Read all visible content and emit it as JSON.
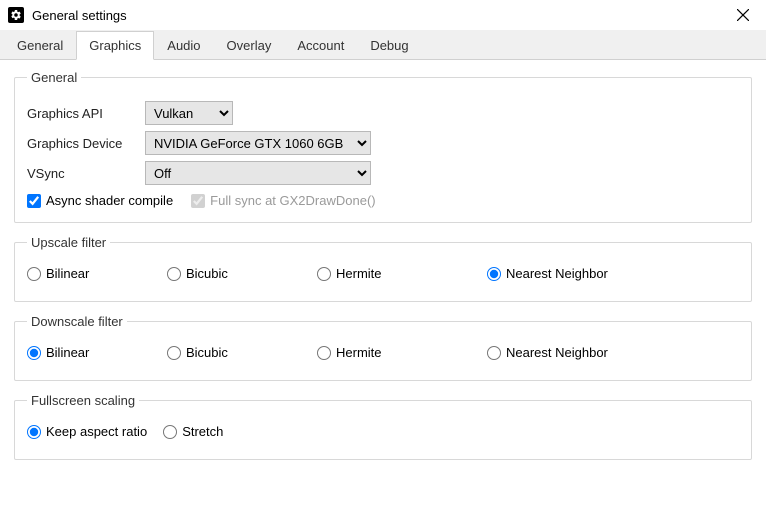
{
  "window": {
    "title": "General settings"
  },
  "tabs": [
    "General",
    "Graphics",
    "Audio",
    "Overlay",
    "Account",
    "Debug"
  ],
  "active_tab": 1,
  "general_group": {
    "legend": "General",
    "graphics_api_label": "Graphics API",
    "graphics_api_value": "Vulkan",
    "graphics_device_label": "Graphics Device",
    "graphics_device_value": "NVIDIA GeForce GTX 1060 6GB",
    "vsync_label": "VSync",
    "vsync_value": "Off",
    "async_shader_label": "Async shader compile",
    "async_shader_checked": true,
    "full_sync_label": "Full sync at GX2DrawDone()",
    "full_sync_checked": true,
    "full_sync_disabled": true
  },
  "upscale": {
    "legend": "Upscale filter",
    "options": [
      "Bilinear",
      "Bicubic",
      "Hermite",
      "Nearest Neighbor"
    ],
    "selected": "Nearest Neighbor"
  },
  "downscale": {
    "legend": "Downscale filter",
    "options": [
      "Bilinear",
      "Bicubic",
      "Hermite",
      "Nearest Neighbor"
    ],
    "selected": "Bilinear"
  },
  "fullscreen": {
    "legend": "Fullscreen scaling",
    "options": [
      "Keep aspect ratio",
      "Stretch"
    ],
    "selected": "Keep aspect ratio"
  }
}
